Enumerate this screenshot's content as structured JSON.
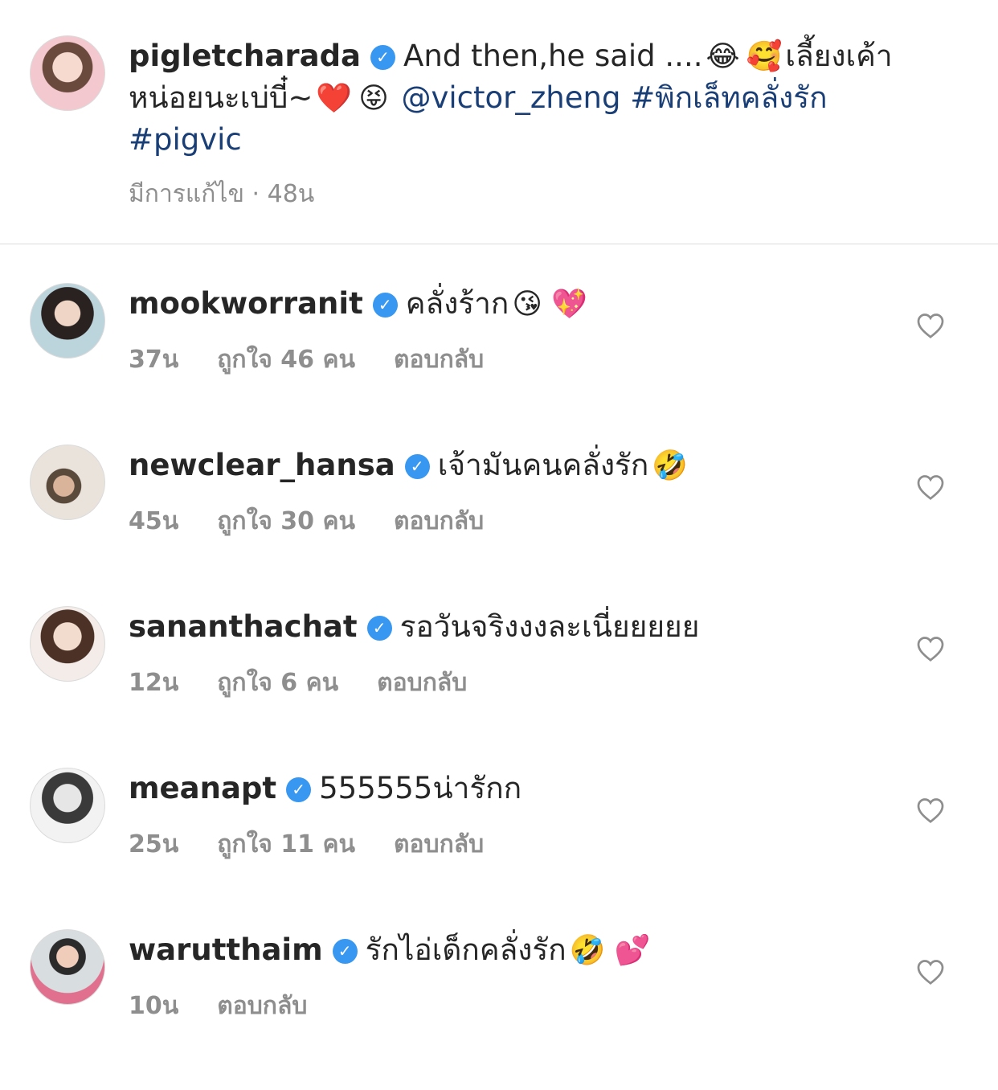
{
  "caption": {
    "username": "pigletcharada",
    "text_part1": "And then,he said ....",
    "emoji1": "😂",
    "emoji2": "🥰",
    "text_part2": "เลี้ยงเค้าหน่อยนะเบ่บี๋~",
    "emoji3": "❤️",
    "emoji4": "😝",
    "mention": "@victor_zheng",
    "hashtag1": "#พิกเล็ทคลั่งรัก",
    "hashtag2": "#pigvic",
    "meta": "มีการแก้ไข · 48น"
  },
  "comments": [
    {
      "username": "mookworranit",
      "text": "คลั่งร้าก",
      "emojis": "😘 💖",
      "time": "37น",
      "likes": "ถูกใจ 46 คน",
      "reply": "ตอบกลับ"
    },
    {
      "username": "newclear_hansa",
      "text": "เจ้ามันคนคลั่งรัก",
      "emojis": "🤣",
      "time": "45น",
      "likes": "ถูกใจ 30 คน",
      "reply": "ตอบกลับ"
    },
    {
      "username": "sananthachat",
      "text": "รอวันจริงงงละเนี่ยยยยย",
      "emojis": "",
      "time": "12น",
      "likes": "ถูกใจ 6 คน",
      "reply": "ตอบกลับ"
    },
    {
      "username": "meanapt",
      "text": "555555น่ารักก",
      "emojis": "",
      "time": "25น",
      "likes": "ถูกใจ 11 คน",
      "reply": "ตอบกลับ"
    },
    {
      "username": "warutthaim",
      "text": "รักไอ่เด็กคลั่งรัก",
      "emojis": "🤣 💕",
      "time": "10น",
      "likes": "",
      "reply": "ตอบกลับ"
    }
  ],
  "colors": {
    "verified": "#3897f0",
    "link": "#1a3f77",
    "meta": "#8e8e8e"
  },
  "icons": {
    "verified": "verified-badge-icon",
    "like": "heart-outline-icon"
  }
}
